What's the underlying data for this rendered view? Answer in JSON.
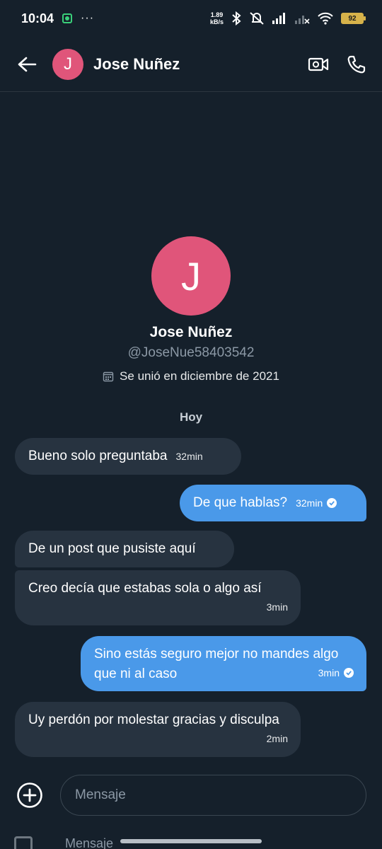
{
  "status_bar": {
    "time": "10:04",
    "more": "···",
    "net_speed_value": "1.89",
    "net_speed_unit": "kB/s",
    "battery": "92"
  },
  "header": {
    "avatar_letter": "J",
    "name": "Jose Nuñez"
  },
  "profile": {
    "avatar_letter": "J",
    "name": "Jose Nuñez",
    "handle": "@JoseNue58403542",
    "joined": "Se unió en diciembre de 2021"
  },
  "day_label": "Hoy",
  "messages": [
    {
      "direction": "in",
      "text": "Bueno solo preguntaba",
      "time": "32min"
    },
    {
      "direction": "out",
      "text": "De que hablas?",
      "time": "32min"
    },
    {
      "direction": "in",
      "text": "De un post que pusiste aquí",
      "time": ""
    },
    {
      "direction": "in",
      "text": "Creo decía que estabas sola o algo así",
      "time": "3min"
    },
    {
      "direction": "out",
      "text": "Sino estás seguro mejor no mandes algo que ni al caso",
      "time": "3min"
    },
    {
      "direction": "in",
      "text": "Uy perdón por molestar gracias y disculpa",
      "time": "2min"
    }
  ],
  "composer": {
    "placeholder": "Mensaje"
  },
  "ghost_bar": {
    "label": "Mensaje"
  },
  "colors": {
    "background": "#15202b",
    "incoming_bubble": "#273340",
    "outgoing_bubble": "#4a99e9",
    "avatar": "#e0557a"
  }
}
